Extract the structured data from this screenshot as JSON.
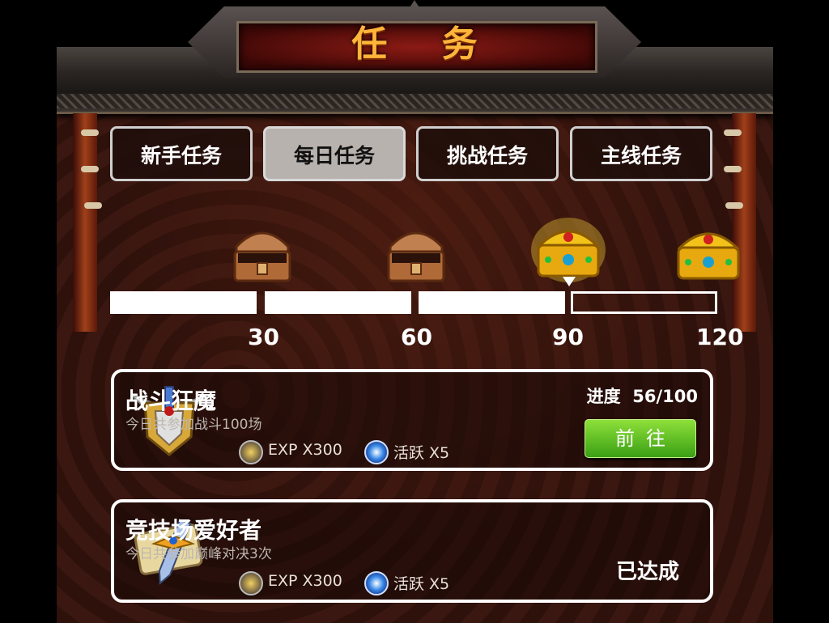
{
  "title": "任 务",
  "tabs": [
    {
      "label": "新手任务",
      "active": false
    },
    {
      "label": "每日任务",
      "active": true
    },
    {
      "label": "挑战任务",
      "active": false
    },
    {
      "label": "主线任务",
      "active": false
    }
  ],
  "activity_progress": {
    "milestones": [
      "30",
      "60",
      "90",
      "120"
    ],
    "chests": [
      "open-bronze-chest-icon",
      "open-bronze-chest-icon",
      "gold-chest-icon",
      "gold-chest-icon"
    ],
    "filled_segments": 3,
    "total_segments": 4
  },
  "tasks": [
    {
      "name": "战斗狂魔",
      "desc": "今日共参加战斗100场",
      "exp": "EXP X300",
      "activity": "活跃 X5",
      "progress": "进度  56/100",
      "button": "前往",
      "status": ""
    },
    {
      "name": "竞技场爱好者",
      "desc": "今日共参加巅峰对决3次",
      "exp": "EXP X300",
      "activity": "活跃 X5",
      "progress": "",
      "button": "",
      "status": "已达成"
    }
  ],
  "colors": {
    "accent": "#ffb43a",
    "go_button": "#5cc222",
    "panel": "#33140e"
  }
}
